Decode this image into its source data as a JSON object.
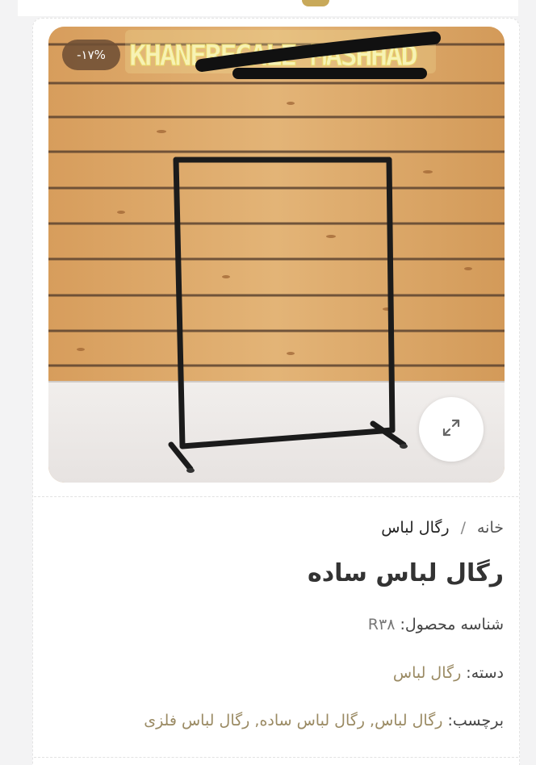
{
  "badge": {
    "sale_label": "-۱۷%"
  },
  "product_image": {
    "sign_text": "KHANEREGALE MASHHAD"
  },
  "breadcrumb": {
    "home": "خانه",
    "separator": "/",
    "current": "رگال لباس"
  },
  "product": {
    "title": "رگال لباس ساده",
    "sku_label": "شناسه محصول:",
    "sku_value": "R۳۸",
    "category_label": "دسته:",
    "category_value": "رگال لباس",
    "tags_label": "برچسب:",
    "tags": [
      "رگال لباس",
      "رگال لباس ساده",
      "رگال لباس فلزی"
    ]
  }
}
